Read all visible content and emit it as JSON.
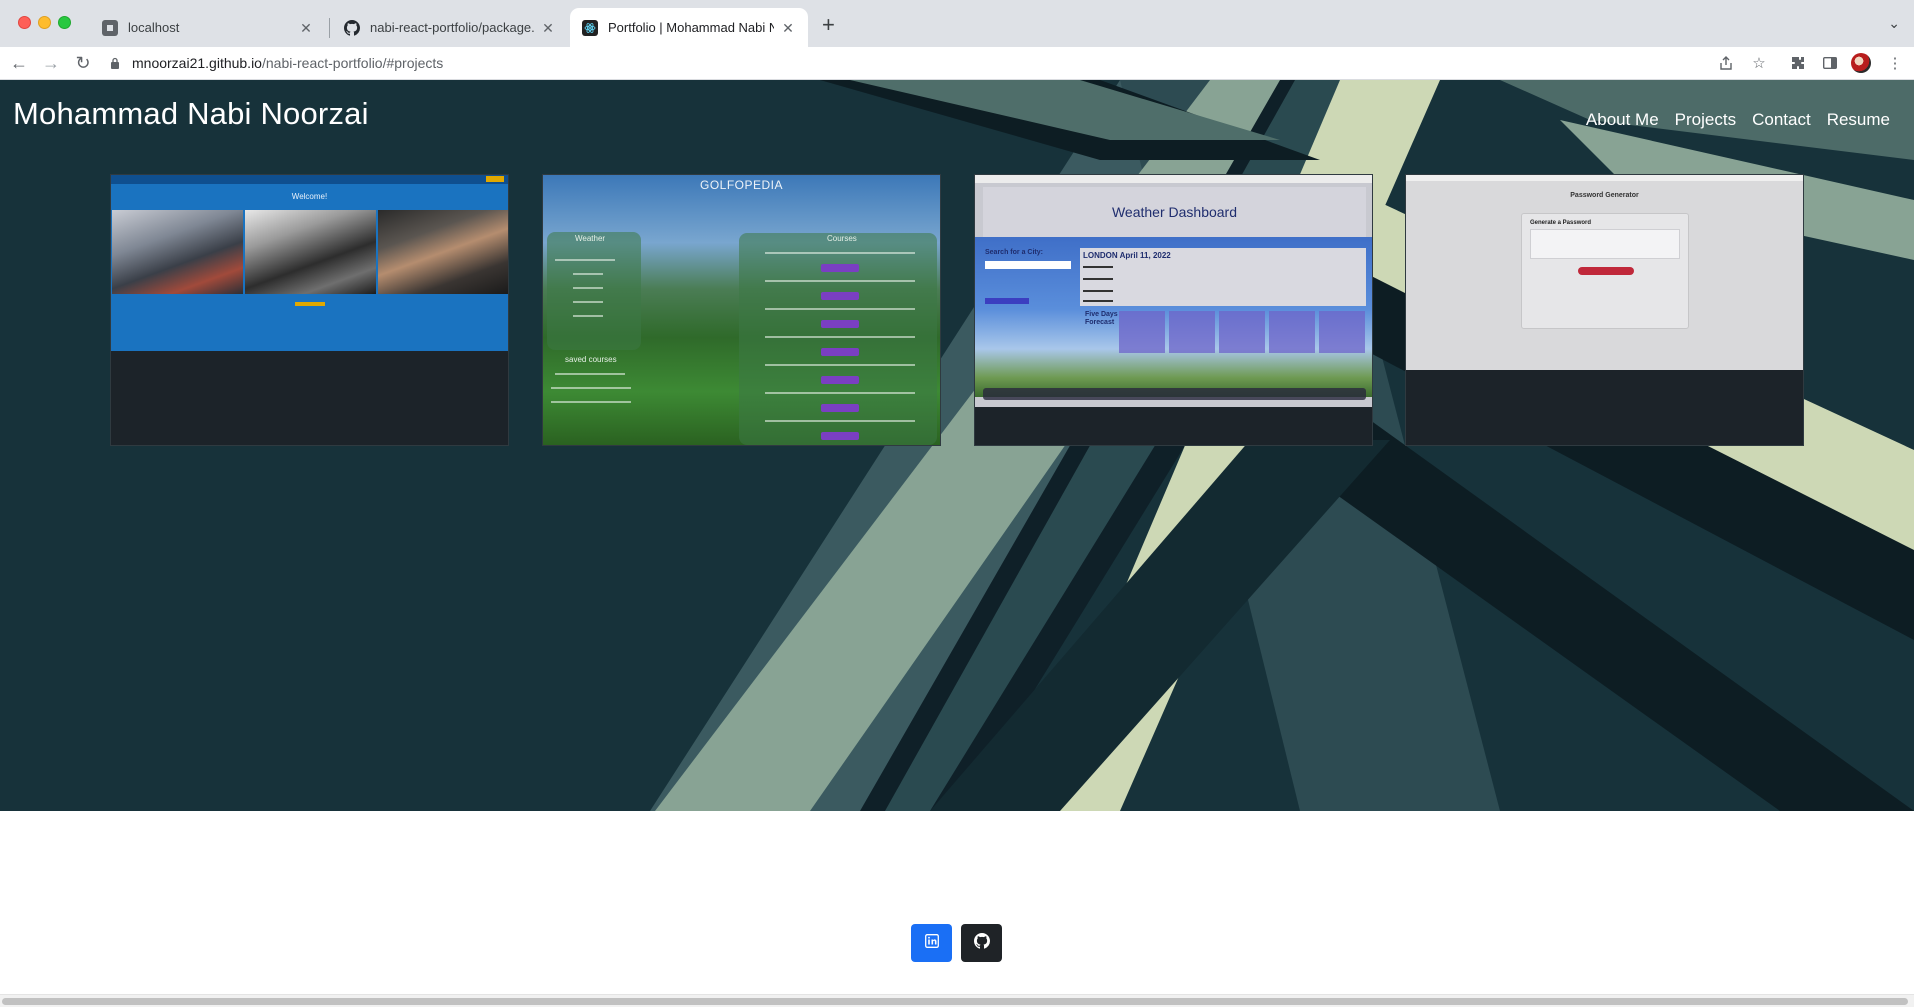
{
  "browser": {
    "tabs": [
      {
        "title": "localhost",
        "active": false
      },
      {
        "title": "nabi-react-portfolio/package.js",
        "active": false
      },
      {
        "title": "Portfolio | Mohammad Nabi No",
        "active": true
      }
    ],
    "url_host": "mnoorzai21.github.io",
    "url_path": "/nabi-react-portfolio/#projects"
  },
  "site": {
    "title": "Mohammad Nabi Noorzai",
    "nav": [
      "About Me",
      "Projects",
      "Contact",
      "Resume"
    ]
  },
  "projects": [
    {
      "welcome": "Welcome!"
    },
    {
      "title": "GOLFOPEDIA",
      "panel_left": "Weather",
      "panel_right": "Courses",
      "saved": "saved courses"
    },
    {
      "title": "Weather Dashboard",
      "search_label": "Search for a City:",
      "today": "LONDON April 11, 2022",
      "forecast_label": "Five Days Forecast"
    },
    {
      "title": "Password Generator",
      "box_heading": "Generate a Password"
    }
  ],
  "footer": {
    "links": [
      {
        "icon": "linkedin-icon",
        "color": "#1a6ff5"
      },
      {
        "icon": "github-icon",
        "color": "#1f2327"
      }
    ]
  },
  "colors": {
    "hero_bg": "#17323a",
    "accent_sage": "#88a394",
    "accent_cream": "#cdd8b5"
  }
}
